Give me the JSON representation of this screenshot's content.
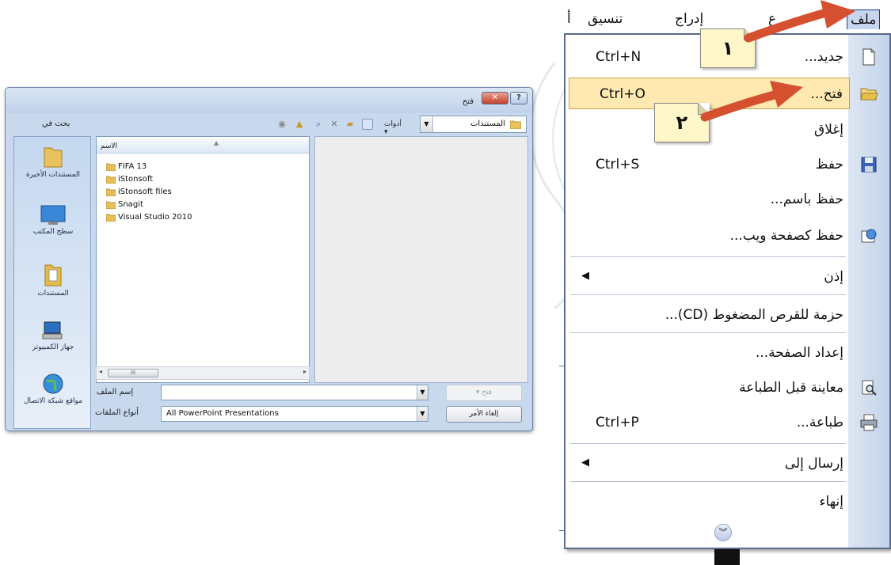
{
  "menubar": {
    "file": "ملف",
    "edit_fragment": "ع",
    "insert": "إدراج",
    "format": "تنسيق",
    "extra": "أ"
  },
  "file_menu": {
    "items": [
      {
        "label": "جديد...",
        "shortcut": "Ctrl+N",
        "icon": "new-document-icon"
      },
      {
        "label": "فتح...",
        "shortcut": "Ctrl+O",
        "icon": "open-folder-icon",
        "highlighted": true
      },
      {
        "label": "إغلاق"
      },
      {
        "label": "حفظ",
        "shortcut": "Ctrl+S",
        "icon": "save-disk-icon"
      },
      {
        "label": "حفظ باسم..."
      },
      {
        "label": "حفظ كصفحة ويب...",
        "icon": "web-page-icon"
      },
      {
        "label": "إذن",
        "submenu": true
      },
      {
        "label": "حزمة للقرص المضغوط (CD)..."
      },
      {
        "label": "إعداد الصفحة..."
      },
      {
        "label": "معاينة قبل الطباعة",
        "icon": "print-preview-icon"
      },
      {
        "label": "طباعة...",
        "shortcut": "Ctrl+P",
        "icon": "printer-icon"
      },
      {
        "label": "إرسال إلى",
        "submenu": true
      },
      {
        "label": "إنهاء"
      }
    ],
    "expand_icon": "chevron-double-down-icon"
  },
  "callouts": {
    "step1": "١",
    "step2": "٢"
  },
  "dialog": {
    "title": "فتح",
    "look_in_label": "بحث في",
    "look_in_value": "المستندات",
    "tools_label": "أدوات",
    "places": [
      {
        "label": "المستندات الأخيرة",
        "icon": "recent-folder-icon"
      },
      {
        "label": "سطح المكتب",
        "icon": "desktop-icon"
      },
      {
        "label": "المستندات",
        "icon": "documents-folder-icon"
      },
      {
        "label": "جهاز الكمبيوتر",
        "icon": "computer-icon"
      },
      {
        "label": "مواقع شبكة الاتصال",
        "icon": "network-globe-icon"
      }
    ],
    "column_name": "الاسم",
    "files": [
      "FIFA 13",
      "iStonsoft",
      "iStonsoft files",
      "Snagit",
      "Visual Studio 2010"
    ],
    "file_name_label": "إسم الملف",
    "file_name_value": "",
    "file_types_label": "أنواع الملفات",
    "file_types_value": "All PowerPoint Presentations",
    "open_button": "فتح",
    "cancel_button": "إلغاء الأمر",
    "scroll_thumb": "III"
  }
}
